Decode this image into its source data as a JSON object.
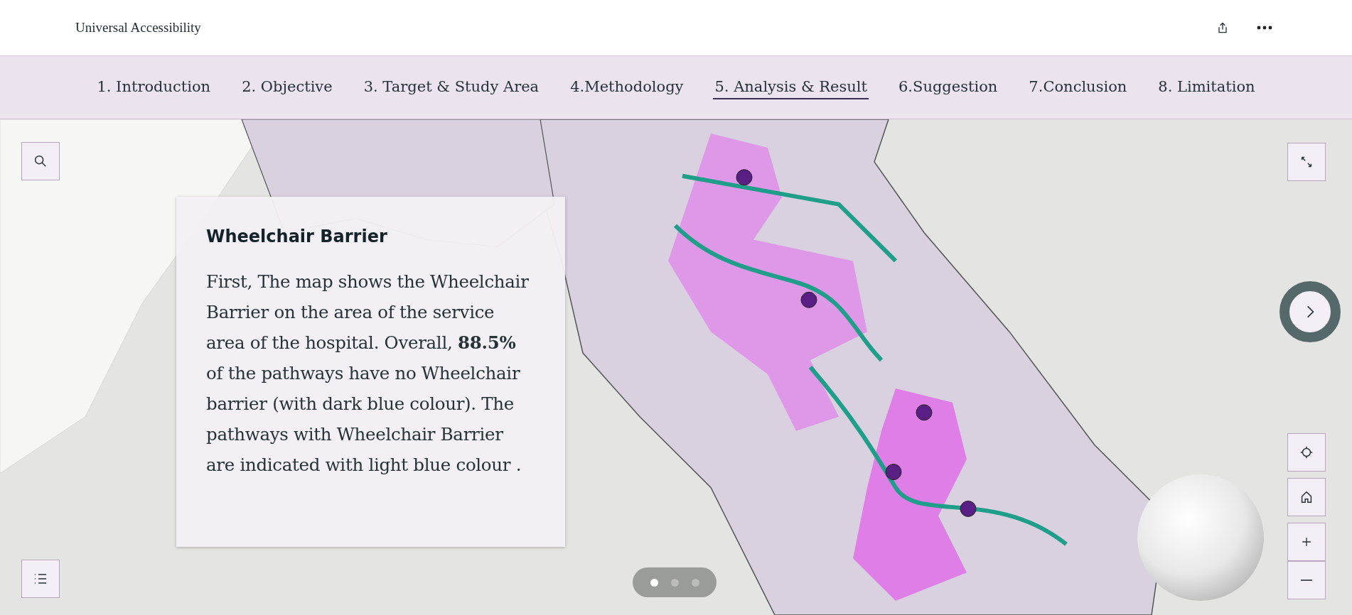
{
  "header": {
    "title": "Universal Accessibility"
  },
  "nav": [
    {
      "label": "1. Introduction",
      "selected": false
    },
    {
      "label": "2. Objective",
      "selected": false
    },
    {
      "label": "3. Target & Study Area",
      "selected": false
    },
    {
      "label": "4.Methodology",
      "selected": false
    },
    {
      "label": "5. Analysis & Result",
      "selected": true
    },
    {
      "label": "6.Suggestion",
      "selected": false
    },
    {
      "label": "7.Conclusion",
      "selected": false
    },
    {
      "label": "8. Limitation",
      "selected": false
    }
  ],
  "panel": {
    "title": "Wheelchair Barrier",
    "body": "First, The map shows the Wheelchair Barrier on the area of the service area of the hospital. Overall, **88.5%** of the pathways have no Wheelchair barrier (with dark blue colour). The pathways with Wheelchair Barrier are indicated with light blue colour ."
  },
  "pager": [
    {
      "selected": true
    },
    {
      "selected": false
    },
    {
      "selected": false
    }
  ]
}
